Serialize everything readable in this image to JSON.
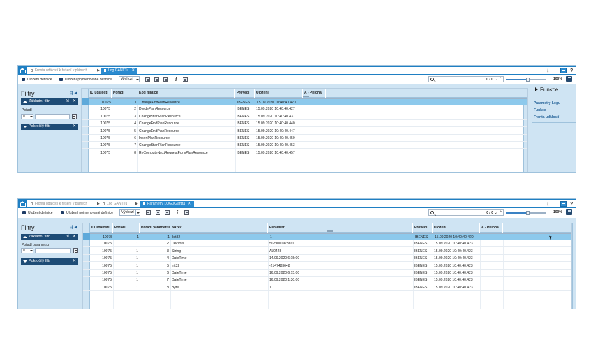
{
  "window1": {
    "tabs": [
      {
        "label": "Fronta událostí k řešení v plánech",
        "active": false
      },
      {
        "label": "Log GANTTu",
        "active": true
      }
    ],
    "toolbar": {
      "save_def": "Uložení definice",
      "save_named_def": "Uložení pojmenované definice",
      "preset": "Výchozí",
      "info": "i",
      "search_count": "0 / 0",
      "zoom": "100%",
      "zoom_level": 0.55
    },
    "filters": {
      "title": "Filtry",
      "basic": "Základní filtr",
      "field_label": "Pořadí",
      "operator": "=",
      "advanced": "Pokročilý filtr"
    },
    "functions": {
      "title": "Funkce",
      "items": [
        "Parametry Logu",
        "Funkce",
        "Fronta událostí"
      ]
    },
    "grid": {
      "headers": [
        "ID události",
        "Pořadí",
        "Kód funkce",
        "Provedl",
        "Uložení",
        "A - Příloha"
      ],
      "rows": [
        [
          "10075",
          "1",
          "ChangeEndPlanResource",
          "IBENES",
          "15.09.2020 10:40:40.420",
          ""
        ],
        [
          "10075",
          "2",
          "DividePlanResource",
          "IBENES",
          "15.09.2020 10:40:40.427",
          ""
        ],
        [
          "10075",
          "3",
          "ChangeStartPlanResource",
          "IBENES",
          "15.09.2020 10:40:40.437",
          ""
        ],
        [
          "10075",
          "4",
          "ChangeEndPlanResource",
          "IBENES",
          "15.09.2020 10:40:40.440",
          ""
        ],
        [
          "10075",
          "5",
          "ChangeEndPlanResource",
          "IBENES",
          "15.09.2020 10:40:40.447",
          ""
        ],
        [
          "10075",
          "6",
          "InsertPlanResource",
          "IBENES",
          "15.09.2020 10:40:40.450",
          ""
        ],
        [
          "10075",
          "7",
          "ChangeStartPlanResource",
          "IBENES",
          "15.09.2020 10:40:40.453",
          ""
        ],
        [
          "10075",
          "8",
          "ReComputeNextRequestFromPlanResource",
          "IBENES",
          "15.09.2020 10:40:40.457",
          ""
        ]
      ]
    }
  },
  "window2": {
    "tabs": [
      {
        "label": "Fronta událostí k řešení v plánech",
        "active": false
      },
      {
        "label": "Log GANTTu",
        "active": false
      },
      {
        "label": "Parametry LOGu Ganttu",
        "active": true
      }
    ],
    "toolbar": {
      "save_def": "Uložení definice",
      "save_named_def": "Uložení pojmenované definice",
      "preset": "Výchozí",
      "info": "i",
      "search_count": "0 / 0",
      "zoom": "100%",
      "zoom_level": 0.55
    },
    "filters": {
      "title": "Filtry",
      "basic": "Základní filtr",
      "field_label": "Pořadí parametru",
      "operator": "=",
      "advanced": "Pokročilý filtr"
    },
    "grid": {
      "headers": [
        "ID události",
        "Pořadí",
        "Pořadí parametru",
        "Název",
        "Parametr",
        "Provedl",
        "Uložení",
        "A - Příloha"
      ],
      "rows": [
        [
          "10075",
          "1",
          "1",
          "Int32",
          "1",
          "IBENES",
          "15.09.2020 10:40:40.420",
          ""
        ],
        [
          "10075",
          "1",
          "2",
          "Decimal",
          "5029001973891",
          "IBENES",
          "15.09.2020 10:40:40.423",
          ""
        ],
        [
          "10075",
          "1",
          "3",
          "String",
          "AL0428",
          "IBENES",
          "15.09.2020 10:40:40.423",
          ""
        ],
        [
          "10075",
          "1",
          "4",
          "DateTime",
          "14.09.2020 6:15:00",
          "IBENES",
          "15.09.2020 10:40:40.423",
          ""
        ],
        [
          "10075",
          "1",
          "5",
          "Int32",
          "-2147483648",
          "IBENES",
          "15.09.2020 10:40:40.423",
          ""
        ],
        [
          "10075",
          "1",
          "6",
          "DateTime",
          "16.09.2020 6:15:00",
          "IBENES",
          "15.09.2020 10:40:40.423",
          ""
        ],
        [
          "10075",
          "1",
          "7",
          "DateTime",
          "16.09.2020 1:30:00",
          "IBENES",
          "15.09.2020 10:40:40.423",
          ""
        ],
        [
          "10075",
          "1",
          "8",
          "Byte",
          "1",
          "IBENES",
          "15.09.2020 10:40:40.423",
          ""
        ]
      ]
    }
  },
  "icons": {
    "home": "home-icon",
    "save": "floppy-icon",
    "search": "search-icon",
    "download": "download-icon",
    "help": "help-icon",
    "monitor": "monitor-icon",
    "close": "close-icon"
  },
  "colors": {
    "accent": "#1f7fc3",
    "panel": "#cfe4f3",
    "filter_header": "#1e4c76",
    "selected_row": "#8dc9ec"
  }
}
